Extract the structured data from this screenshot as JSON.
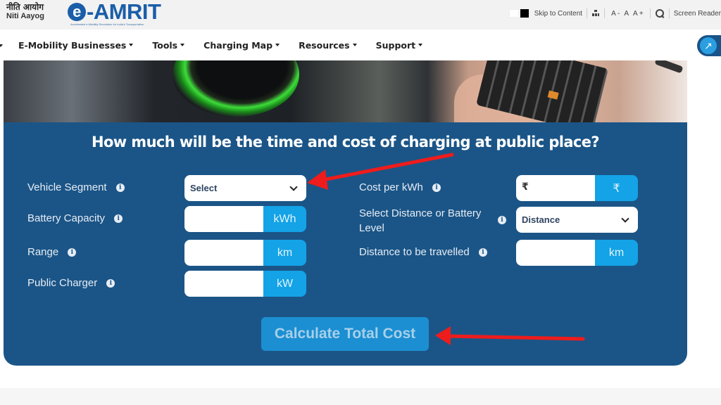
{
  "header": {
    "niti_hindi": "नीति आयोग",
    "niti_english": "Niti Aayog",
    "brand_e": "e",
    "brand_name": "-AMRIT",
    "brand_tagline": "Accelerated e-Mobility Revolution for India's Transportation"
  },
  "utility_bar": {
    "skip_to_content": "Skip to Content",
    "font_decrease": "A -",
    "font_normal": "A",
    "font_increase": "A +",
    "screen_reader": "Screen Reader"
  },
  "nav": {
    "items": [
      {
        "label": "E-Mobility Businesses"
      },
      {
        "label": "Tools"
      },
      {
        "label": "Charging Map"
      },
      {
        "label": "Resources"
      },
      {
        "label": "Support"
      }
    ],
    "share_icon": "↗"
  },
  "calculator": {
    "title": "How much will be the time and cost of charging at public place?",
    "left_fields": [
      {
        "label": "Vehicle Segment",
        "type": "select",
        "value": "Select"
      },
      {
        "label": "Battery Capacity",
        "type": "input",
        "value": "",
        "unit": "kWh"
      },
      {
        "label": "Range",
        "type": "input",
        "value": "",
        "unit": "km"
      },
      {
        "label": "Public Charger",
        "type": "input",
        "value": "",
        "unit": "kW"
      }
    ],
    "right_fields": [
      {
        "label": "Cost per kWh",
        "type": "input",
        "prefix": "₹",
        "value": "",
        "unit": "₹"
      },
      {
        "label_line1": "Select Distance or Battery",
        "label_line2": "Level",
        "type": "select",
        "value": "Distance"
      },
      {
        "label": "Distance to be travelled",
        "type": "input",
        "value": "",
        "unit": "km"
      }
    ],
    "info_glyph": "i",
    "calculate_button": "Calculate Total Cost"
  },
  "colors": {
    "panel_bg": "#1b5587",
    "unit_addon": "#13a3e6",
    "button_bg": "#1b8fd2",
    "brand_blue": "#1a5ea8",
    "annotation_arrow": "#ee1c1c"
  }
}
